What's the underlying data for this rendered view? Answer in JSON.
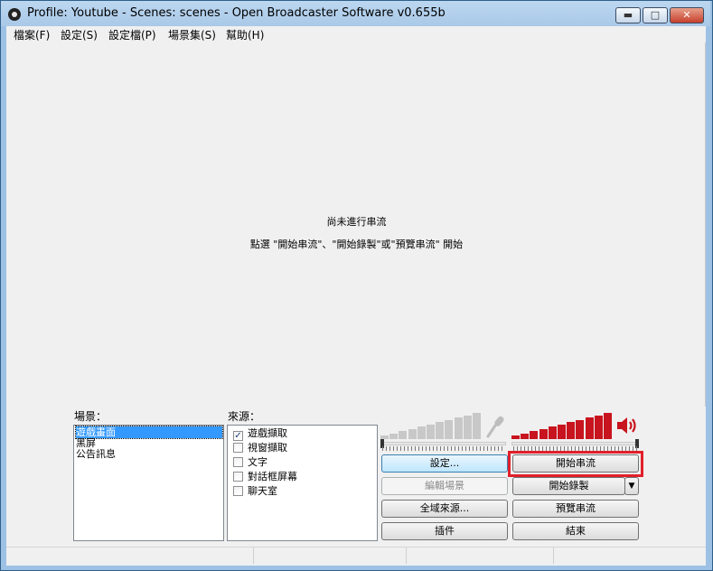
{
  "window": {
    "title": "Profile: Youtube - Scenes: scenes - Open Broadcaster Software v0.655b"
  },
  "window_controls": {
    "minimize": "▬",
    "maximize": "□",
    "close": "✕"
  },
  "menu": [
    "檔案(F)",
    "設定(S)",
    "設定檔(P)",
    "場景集(S)",
    "幫助(H)"
  ],
  "preview": {
    "status_title": "尚未進行串流",
    "status_hint": "點選 \"開始串流\"、\"開始錄製\"或\"預覽串流\" 開始"
  },
  "scenes": {
    "label": "場景：",
    "items": [
      "遊戲畫面",
      "黑屏",
      "公告訊息"
    ],
    "selected_index": 0
  },
  "sources": {
    "label": "來源：",
    "items": [
      {
        "name": "遊戲擷取",
        "checked": true
      },
      {
        "name": "視窗擷取",
        "checked": false
      },
      {
        "name": "文字",
        "checked": false
      },
      {
        "name": "對話框屏幕",
        "checked": false
      },
      {
        "name": "聊天室",
        "checked": false
      }
    ]
  },
  "buttons": {
    "settings": "設定...",
    "edit_scene": "編輯場景",
    "global_sources": "全域來源...",
    "plugins": "插件",
    "start_stream": "開始串流",
    "start_record": "開始錄製",
    "preview_stream": "預覽串流",
    "exit": "結束",
    "dropdown_arrow": "▼"
  },
  "audio": {
    "mic_icon": "microphone-icon",
    "speaker_icon": "speaker-icon",
    "mic_level": 0,
    "desktop_level": 1.0,
    "inactive_color": "#c8c8c8",
    "active_color": "#c8141e"
  },
  "highlight_color": "#e0202a"
}
